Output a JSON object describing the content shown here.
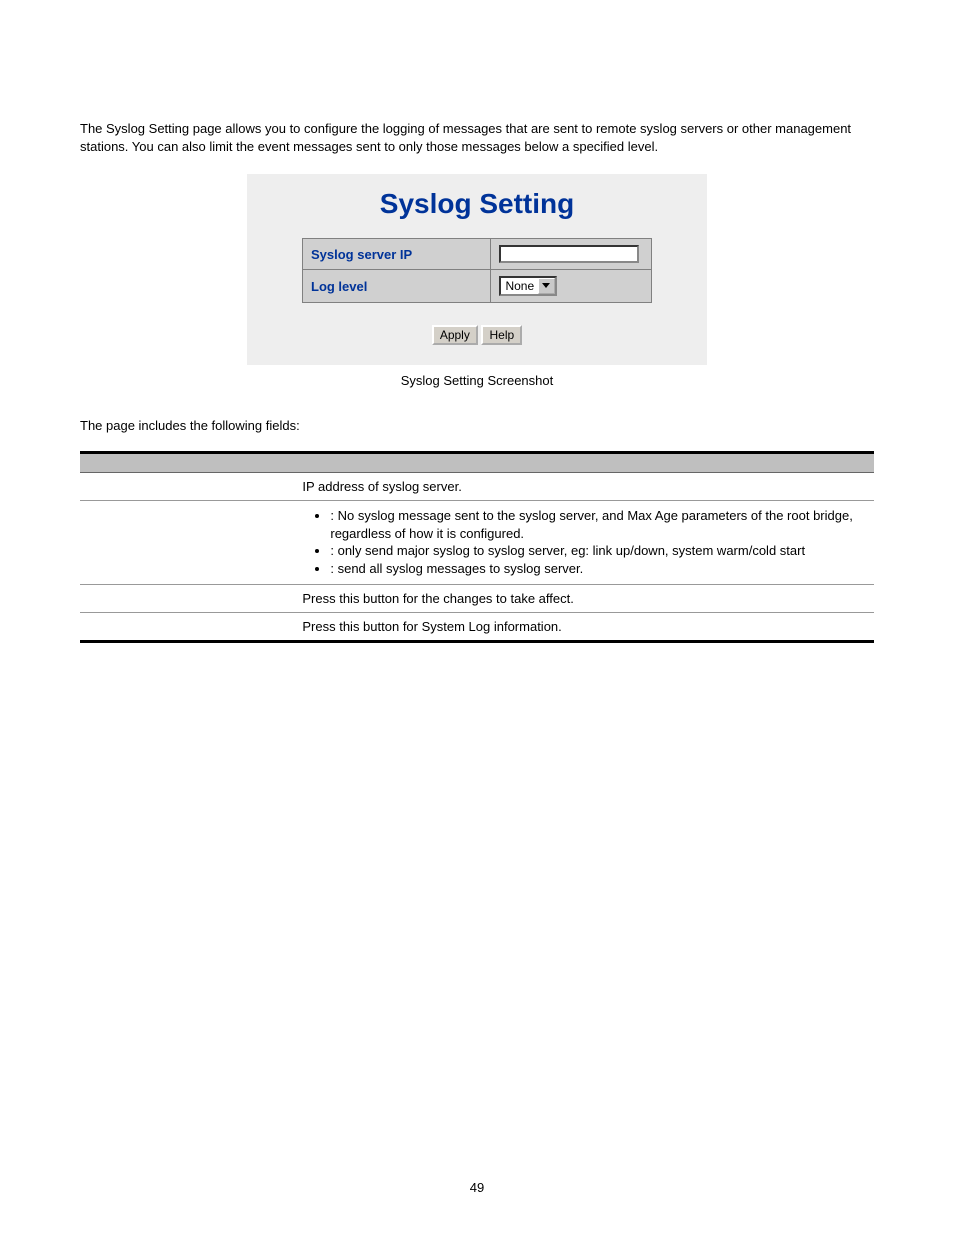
{
  "intro": "The Syslog Setting page allows you to configure the logging of messages that are sent to remote syslog servers or other management stations. You can also limit the event messages sent to only those messages below a specified level.",
  "screenshot": {
    "title": "Syslog Setting",
    "rows": {
      "ip_label": "Syslog server IP",
      "ip_value": "",
      "level_label": "Log level",
      "level_value": "None"
    },
    "buttons": {
      "apply": "Apply",
      "help": "Help"
    },
    "caption": "Syslog Setting Screenshot"
  },
  "fields_intro": "The page includes the following fields:",
  "table": {
    "rows": [
      {
        "object": "",
        "plain": "IP address of syslog server."
      },
      {
        "object": "",
        "bullets": [
          ": No syslog message sent to the syslog server, and Max Age parameters of the root bridge, regardless of how it is configured.",
          ": only send major syslog to syslog server, eg: link up/down, system warm/cold start",
          ": send all syslog messages to syslog server."
        ]
      },
      {
        "object": "",
        "plain": "Press this button for the changes to take affect."
      },
      {
        "object": "",
        "plain": "Press this button for System Log information."
      }
    ]
  },
  "page_number": "49"
}
